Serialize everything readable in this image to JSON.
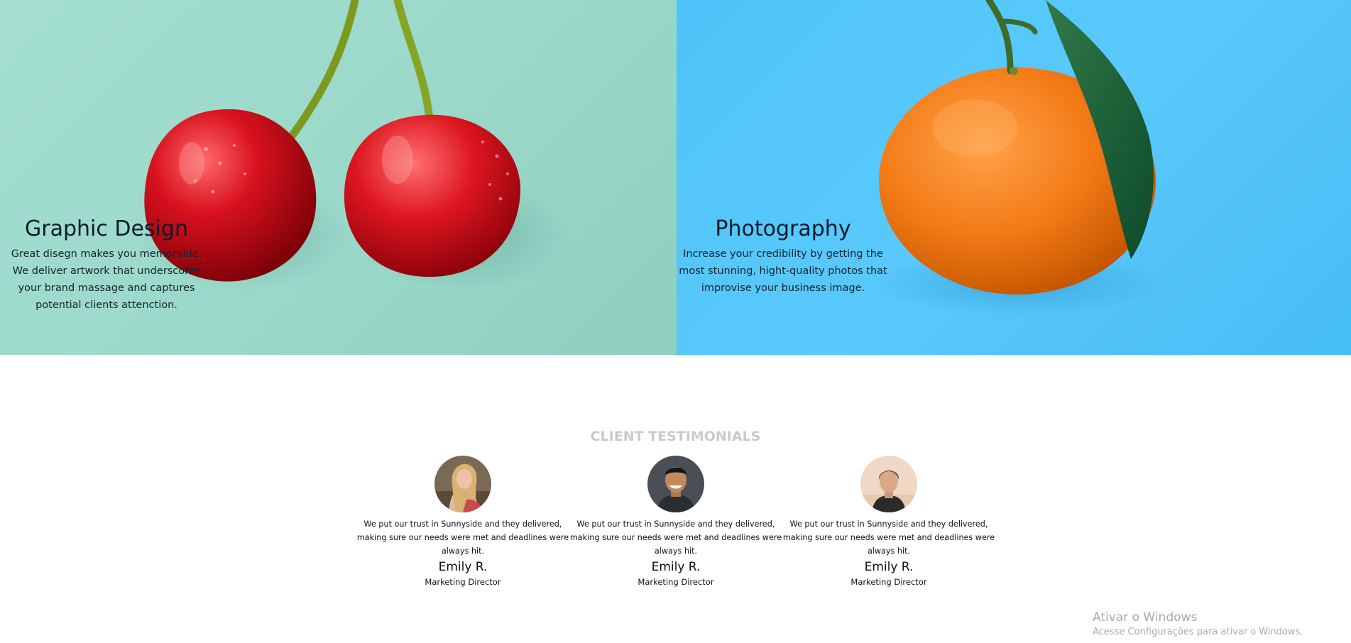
{
  "services": [
    {
      "title": "Graphic Design",
      "description": "Great disegn makes you memorable. We deliver artwork that underscores your brand massage and captures potential clients attenction.",
      "image": "cherries-image"
    },
    {
      "title": "Photography",
      "description": "Increase your credibility by getting the most stunning, hight-quality photos that improvise your business image.",
      "image": "orange-image"
    }
  ],
  "testimonials": {
    "title": "CLIENT TESTIMONIALS",
    "items": [
      {
        "quote": "We put our trust in Sunnyside and they delivered, making sure our needs were met and deadlines were always hit.",
        "name": "Emily R.",
        "role": "Marketing Director",
        "avatar": "woman-long-hair-avatar"
      },
      {
        "quote": "We put our trust in Sunnyside and they delivered, making sure our needs were met and deadlines were always hit.",
        "name": "Emily R.",
        "role": "Marketing Director",
        "avatar": "smiling-man-avatar"
      },
      {
        "quote": "We put our trust in Sunnyside and they delivered, making sure our needs were met and deadlines were always hit.",
        "name": "Emily R.",
        "role": "Marketing Director",
        "avatar": "short-hair-woman-avatar"
      }
    ]
  },
  "watermark": {
    "title": "Ativar o Windows",
    "subtitle": "Acesse Configurações para ativar o Windows."
  },
  "colors": {
    "graphic_bg": "#a4dfd1",
    "photo_bg": "#55c6fa",
    "section_title": "#c9cacc",
    "text": "#111111"
  }
}
